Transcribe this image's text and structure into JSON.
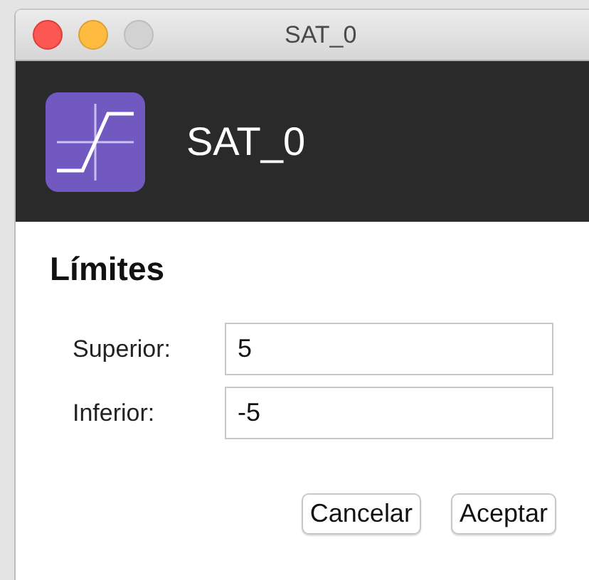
{
  "window": {
    "title": "SAT_0"
  },
  "header": {
    "title": "SAT_0"
  },
  "section": {
    "title": "Límites"
  },
  "fields": [
    {
      "label": "Superior:",
      "value": "5"
    },
    {
      "label": "Inferior:",
      "value": "-5"
    }
  ],
  "buttons": [
    "Cancelar",
    "Aceptar"
  ]
}
